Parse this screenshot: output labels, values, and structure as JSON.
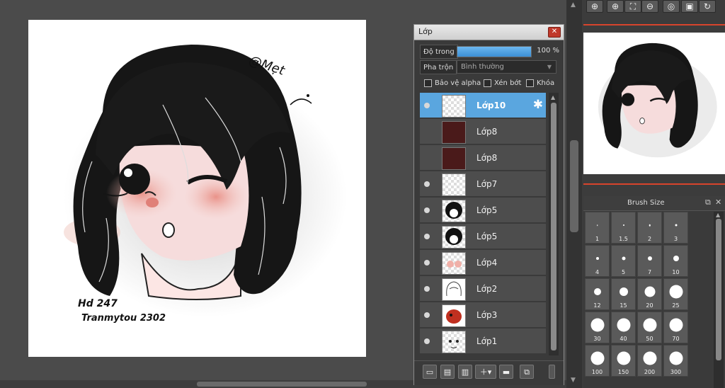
{
  "canvas": {
    "signature_handle": "@Mẹt",
    "signature_line1": "Hd 247",
    "signature_line2": "Tranmytou 2302"
  },
  "layer_panel": {
    "title": "Lớp",
    "opacity": {
      "label": "Độ trong",
      "value": "100 %",
      "level": 1.0
    },
    "blend": {
      "label": "Pha trộn",
      "value": "Bình thường"
    },
    "options": [
      "Bảo vệ alpha",
      "Xén bớt",
      "Khóa"
    ],
    "layers": [
      {
        "name": "Lớp10",
        "visible": true,
        "selected": true,
        "thumb": "empty-sketch"
      },
      {
        "name": "Lớp8",
        "visible": false,
        "selected": false,
        "thumb": "dark-red"
      },
      {
        "name": "Lớp8",
        "visible": false,
        "selected": false,
        "thumb": "dark-red"
      },
      {
        "name": "Lớp7",
        "visible": true,
        "selected": false,
        "thumb": "transparent"
      },
      {
        "name": "Lớp5",
        "visible": true,
        "selected": false,
        "thumb": "hair"
      },
      {
        "name": "Lớp5",
        "visible": true,
        "selected": false,
        "thumb": "hair"
      },
      {
        "name": "Lớp4",
        "visible": true,
        "selected": false,
        "thumb": "blush"
      },
      {
        "name": "Lớp2",
        "visible": true,
        "selected": false,
        "thumb": "sketch"
      },
      {
        "name": "Lớp3",
        "visible": true,
        "selected": false,
        "thumb": "red-shape"
      },
      {
        "name": "Lớp1",
        "visible": true,
        "selected": false,
        "thumb": "face-lines"
      }
    ]
  },
  "brush_panel": {
    "title": "Brush Size",
    "sizes": [
      "1",
      "1.5",
      "2",
      "3",
      "4",
      "5",
      "7",
      "10",
      "12",
      "15",
      "20",
      "25",
      "30",
      "40",
      "50",
      "70",
      "100",
      "150",
      "200",
      "300"
    ]
  },
  "navigator": {
    "buttons": [
      "zoom-in-icon",
      "zoom-out-icon",
      "fit-icon",
      "zoom-out-icon",
      "rotate-icon",
      "fullscreen-icon",
      "rotate-reset-icon"
    ]
  }
}
